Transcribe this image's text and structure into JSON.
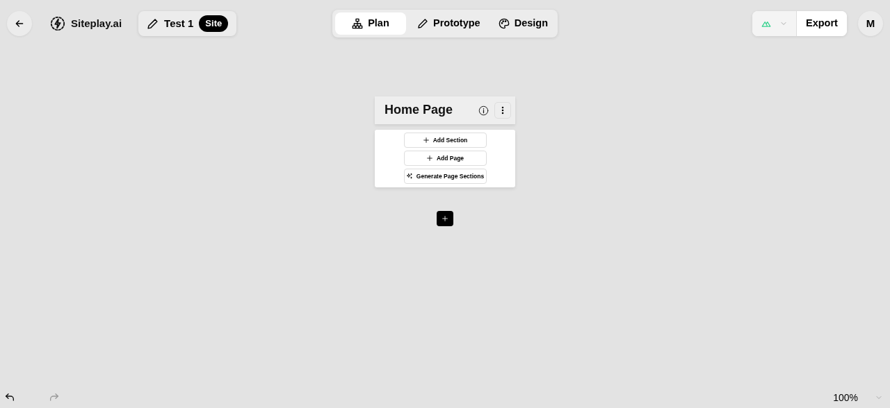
{
  "header": {
    "brand": "Siteplay.ai",
    "project": {
      "name": "Test 1",
      "badge": "Site"
    },
    "tabs": [
      {
        "label": "Plan",
        "selected": true
      },
      {
        "label": "Prototype",
        "selected": false
      },
      {
        "label": "Design",
        "selected": false
      }
    ],
    "export": "Export",
    "avatar": "M"
  },
  "page_node": {
    "title": "Home Page",
    "actions": [
      {
        "label": "Add Section",
        "kind": "add"
      },
      {
        "label": "Add Page",
        "kind": "add"
      },
      {
        "label": "Generate Page Sections",
        "kind": "generate"
      }
    ]
  },
  "history": {
    "undo_disabled": false,
    "redo_disabled": true
  },
  "zoom": "100%"
}
